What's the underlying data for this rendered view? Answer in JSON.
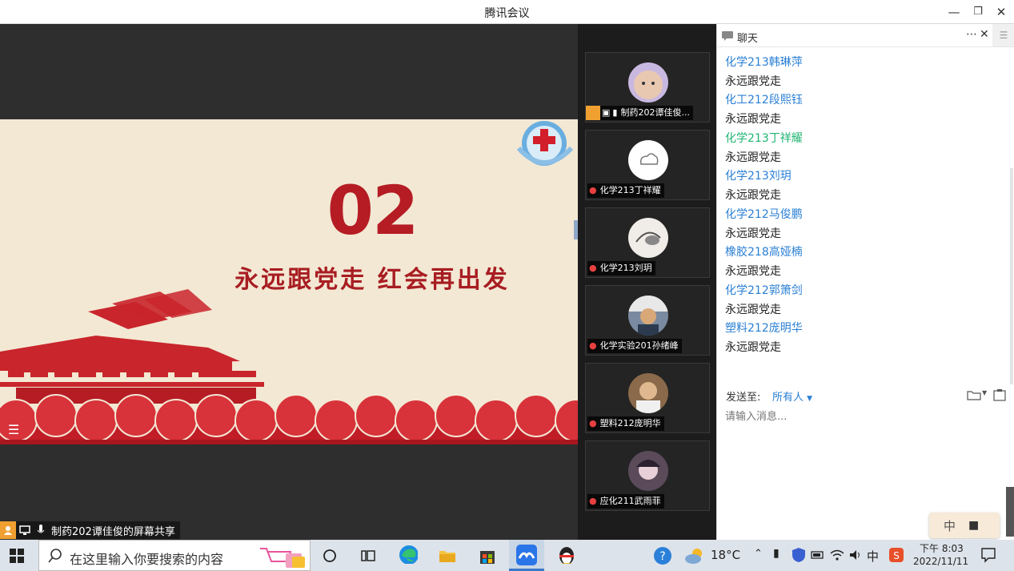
{
  "window": {
    "title": "腾讯会议"
  },
  "slide": {
    "number": "02",
    "subtitle": "永远跟党走   红会再出发"
  },
  "share": {
    "label": "制药202谭佳俊的屏幕共享"
  },
  "participants": [
    {
      "name": "制药202谭佳俊...",
      "avatar_color": "#c8b8e0"
    },
    {
      "name": "化学213丁祥耀",
      "avatar_color": "#ffffff"
    },
    {
      "name": "化学213刘玥",
      "avatar_color": "#f0ece8"
    },
    {
      "name": "化学实验201孙绪峰",
      "avatar_color": "#7a8aa0"
    },
    {
      "name": "塑料212庞明华",
      "avatar_color": "#8a6a4a"
    },
    {
      "name": "应化211武雨菲",
      "avatar_color": "#5a4a5a"
    }
  ],
  "chat": {
    "title": "聊天",
    "messages": [
      {
        "text": "永远跟党走",
        "color": "#222222"
      },
      {
        "text": "化学213韩琳萍",
        "color": "#2a7fd4"
      },
      {
        "text": "永远跟党走",
        "color": "#222222"
      },
      {
        "text": "化工212段熙钰",
        "color": "#2a7fd4"
      },
      {
        "text": "永远跟党走",
        "color": "#222222"
      },
      {
        "text": "化学213丁祥耀",
        "color": "#22b573"
      },
      {
        "text": "永远跟党走",
        "color": "#222222"
      },
      {
        "text": "化学213刘玥",
        "color": "#2a7fd4"
      },
      {
        "text": "永远跟党走",
        "color": "#222222"
      },
      {
        "text": "化学212马俊鹏",
        "color": "#2a7fd4"
      },
      {
        "text": "永远跟党走",
        "color": "#222222"
      },
      {
        "text": "橡胶218高娅楠",
        "color": "#2a7fd4"
      },
      {
        "text": "永远跟党走",
        "color": "#222222"
      },
      {
        "text": "化学212郭箫剑",
        "color": "#2a7fd4"
      },
      {
        "text": "永远跟党走",
        "color": "#222222"
      },
      {
        "text": "塑料212庞明华",
        "color": "#2a7fd4"
      },
      {
        "text": "永远跟党走",
        "color": "#222222"
      }
    ],
    "send_to_label": "发送至:",
    "send_to_value": "所有人",
    "input_placeholder": "请输入消息..."
  },
  "ime": {
    "label": "中"
  },
  "taskbar": {
    "search_placeholder": "在这里输入你要搜索的内容",
    "weather": "18°C",
    "ime": "中",
    "time": "下午 8:03",
    "date": "2022/11/11"
  }
}
